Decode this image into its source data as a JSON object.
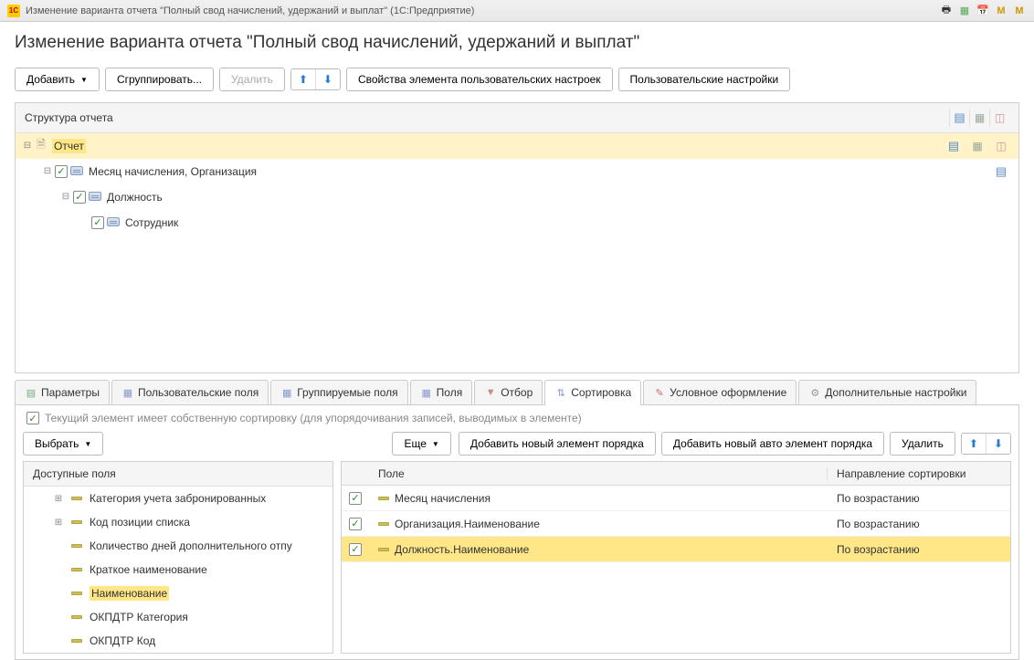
{
  "window": {
    "logo": "1C",
    "title": "Изменение варианта отчета \"Полный свод начислений, удержаний и выплат\"  (1С:Предприятие)"
  },
  "header": {
    "title": "Изменение варианта отчета \"Полный свод начислений, удержаний и выплат\""
  },
  "toolbar": {
    "add": "Добавить",
    "group": "Сгруппировать...",
    "delete": "Удалить",
    "props": "Свойства элемента пользовательских настроек",
    "user_settings": "Пользовательские настройки"
  },
  "structure": {
    "title": "Структура отчета",
    "node0": "Отчет",
    "node1": "Месяц начисления, Организация",
    "node2": "Должность",
    "node3": "Сотрудник"
  },
  "tabs": {
    "params": "Параметры",
    "user_fields": "Пользовательские поля",
    "group_fields": "Группируемые поля",
    "fields": "Поля",
    "filter": "Отбор",
    "sort": "Сортировка",
    "cond": "Условное оформление",
    "extra": "Дополнительные настройки"
  },
  "sort_panel": {
    "own_sort": "Текущий элемент имеет собственную сортировку (для  упорядочивания записей, выводимых в элементе)",
    "select": "Выбрать",
    "more": "Еще",
    "add_new": "Добавить новый элемент порядка",
    "add_auto": "Добавить новый авто элемент порядка",
    "delete": "Удалить"
  },
  "avail": {
    "title": "Доступные поля",
    "f0": "Категория учета забронированных",
    "f1": "Код позиции списка",
    "f2": "Количество дней дополнительного отпу",
    "f3": "Краткое наименование",
    "f4": "Наименование",
    "f5": "ОКПДТР Категория",
    "f6": "ОКПДТР Код"
  },
  "grid": {
    "col_field": "Поле",
    "col_dir": "Направление сортировки",
    "r0f": "Месяц начисления",
    "r0d": "По возрастанию",
    "r1f": "Организация.Наименование",
    "r1d": "По возрастанию",
    "r2f": "Должность.Наименование",
    "r2d": "По возрастанию"
  }
}
